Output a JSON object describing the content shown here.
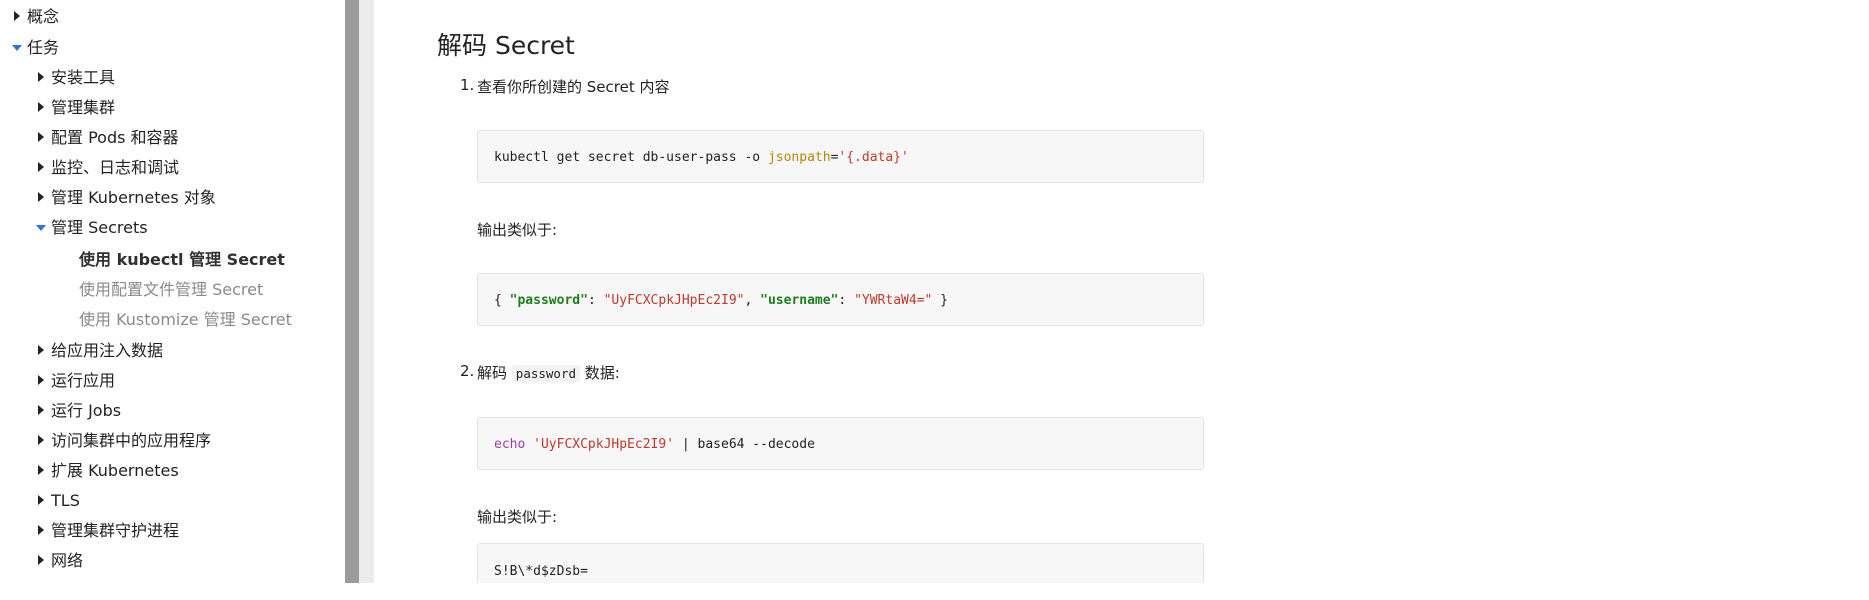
{
  "sidebar": {
    "items": [
      {
        "label": "概念",
        "state": "collapsed",
        "level": 0
      },
      {
        "label": "任务",
        "state": "expanded",
        "level": 0
      },
      {
        "label": "安装工具",
        "state": "collapsed",
        "level": 1
      },
      {
        "label": "管理集群",
        "state": "collapsed",
        "level": 1
      },
      {
        "label": "配置 Pods 和容器",
        "state": "collapsed",
        "level": 1
      },
      {
        "label": "监控、日志和调试",
        "state": "collapsed",
        "level": 1
      },
      {
        "label": "管理 Kubernetes 对象",
        "state": "collapsed",
        "level": 1
      },
      {
        "label": "管理 Secrets",
        "state": "expanded",
        "level": 1
      },
      {
        "label": "使用 kubectl 管理 Secret",
        "state": "active",
        "level": 2
      },
      {
        "label": "使用配置文件管理 Secret",
        "state": "leaf",
        "level": 2
      },
      {
        "label": "使用 Kustomize 管理 Secret",
        "state": "leaf",
        "level": 2
      },
      {
        "label": "给应用注入数据",
        "state": "collapsed",
        "level": 1
      },
      {
        "label": "运行应用",
        "state": "collapsed",
        "level": 1
      },
      {
        "label": "运行 Jobs",
        "state": "collapsed",
        "level": 1
      },
      {
        "label": "访问集群中的应用程序",
        "state": "collapsed",
        "level": 1
      },
      {
        "label": "扩展 Kubernetes",
        "state": "collapsed",
        "level": 1
      },
      {
        "label": "TLS",
        "state": "collapsed",
        "level": 1
      },
      {
        "label": "管理集群守护进程",
        "state": "collapsed",
        "level": 1
      },
      {
        "label": "网络",
        "state": "collapsed",
        "level": 1
      }
    ]
  },
  "main": {
    "heading": "解码 Secret",
    "steps": [
      {
        "number": "1.",
        "text": "查看你所创建的 Secret 内容"
      },
      {
        "number": "2.",
        "text_before": "解码",
        "inline_code": "password",
        "text_after": "数据:"
      }
    ],
    "output_label_1": "输出类似于:",
    "output_label_2": "输出类似于:",
    "code1": {
      "plain": "kubectl get secret db-user-pass -o ",
      "attr": "jsonpath",
      "eq": "=",
      "str": "'{.data}'"
    },
    "code2": {
      "open": "{ ",
      "k1": "\"password\"",
      "c1": ": ",
      "v1": "\"UyFCXCpkJHpEc2I9\"",
      "sep": ", ",
      "k2": "\"username\"",
      "c2": ": ",
      "v2": "\"YWRtaW4=\"",
      "close": " }"
    },
    "code3": {
      "kw": "echo",
      "sp": " ",
      "str": "'UyFCXCpkJHpEc2I9'",
      "rest": " | base64 --decode"
    },
    "code4": "S!B\\*d$zDsb="
  },
  "colors": {
    "accent": "#3371e3",
    "code_bg": "#f7f7f7",
    "scrollbar": "#9b9b9b"
  }
}
